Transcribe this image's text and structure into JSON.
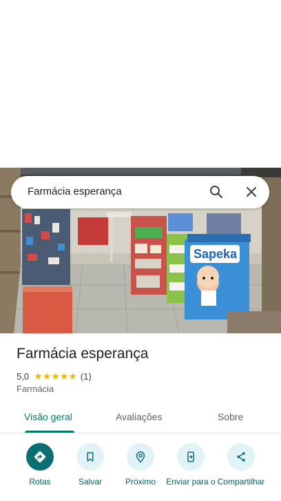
{
  "search": {
    "query": "Farmácia esperança"
  },
  "place": {
    "title": "Farmácia esperança",
    "rating": "5,0",
    "stars": 5,
    "review_count": "(1)",
    "category": "Farmácia"
  },
  "photo": {
    "display_sign": "Sapeka"
  },
  "tabs": [
    {
      "label": "Visão geral",
      "active": true
    },
    {
      "label": "Avaliações",
      "active": false
    },
    {
      "label": "Sobre",
      "active": false
    }
  ],
  "actions": [
    {
      "label": "Rotas",
      "icon": "directions-icon"
    },
    {
      "label": "Salvar",
      "icon": "bookmark-icon"
    },
    {
      "label": "Próximo",
      "icon": "nearby-icon"
    },
    {
      "label": "Enviar para o",
      "icon": "send-to-phone-icon"
    },
    {
      "label": "Compartilhar",
      "icon": "share-icon"
    }
  ],
  "colors": {
    "accent": "#00796b",
    "primary_button": "#0a6e72",
    "secondary_button": "#e2f3f7",
    "stars": "#f5b400"
  }
}
